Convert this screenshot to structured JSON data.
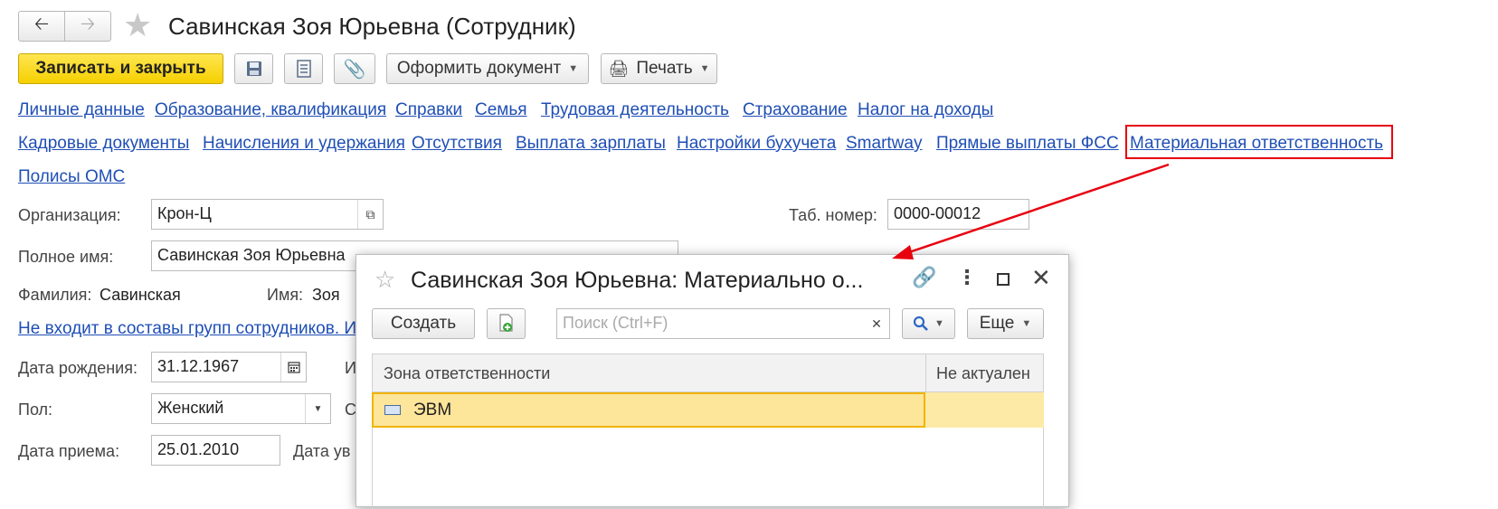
{
  "window": {
    "title": "Савинская Зоя Юрьевна (Сотрудник)"
  },
  "toolbar": {
    "save_close_label": "Записать и закрыть",
    "create_document_label": "Оформить документ",
    "print_label": "Печать"
  },
  "nav_links": {
    "row1": [
      "Личные данные",
      "Образование, квалификация",
      "Справки",
      "Семья",
      "Трудовая деятельность",
      "Страхование",
      "Налог на доходы"
    ],
    "row2": [
      "Кадровые документы",
      "Начисления и удержания",
      "Отсутствия",
      "Выплата зарплаты",
      "Настройки бухучета",
      "Smartway",
      "Прямые выплаты ФСС",
      "Материальная ответственность"
    ],
    "row3": [
      "Полисы ОМС"
    ]
  },
  "form": {
    "organization_label": "Организация:",
    "organization_value": "Крон-Ц",
    "tab_number_label": "Таб. номер:",
    "tab_number_value": "0000-00012",
    "full_name_label": "Полное имя:",
    "full_name_value": "Савинская Зоя Юрьевна",
    "surname_label": "Фамилия:",
    "surname_value": "Савинская",
    "name_label": "Имя:",
    "name_value": "Зоя",
    "groups_link": "Не входит в составы групп сотрудников. Из",
    "birth_date_label": "Дата рождения:",
    "birth_date_value": "31.12.1967",
    "gender_label": "Пол:",
    "gender_value": "Женский",
    "hire_date_label": "Дата приема:",
    "hire_date_value": "25.01.2010",
    "dismissal_label": "Дата ув"
  },
  "dialog": {
    "title": "Савинская Зоя Юрьевна: Материально о...",
    "create_label": "Создать",
    "search_placeholder": "Поиск (Ctrl+F)",
    "more_label": "Еще",
    "columns": [
      "Зона ответственности",
      "Не актуален"
    ],
    "rows": [
      {
        "zone": "ЭВМ",
        "not_actual": ""
      }
    ]
  },
  "colors": {
    "link": "#1f4fb5",
    "primary_button": "#f5cf00",
    "highlight": "#e8000e",
    "selected_row": "#fdeaa6"
  }
}
